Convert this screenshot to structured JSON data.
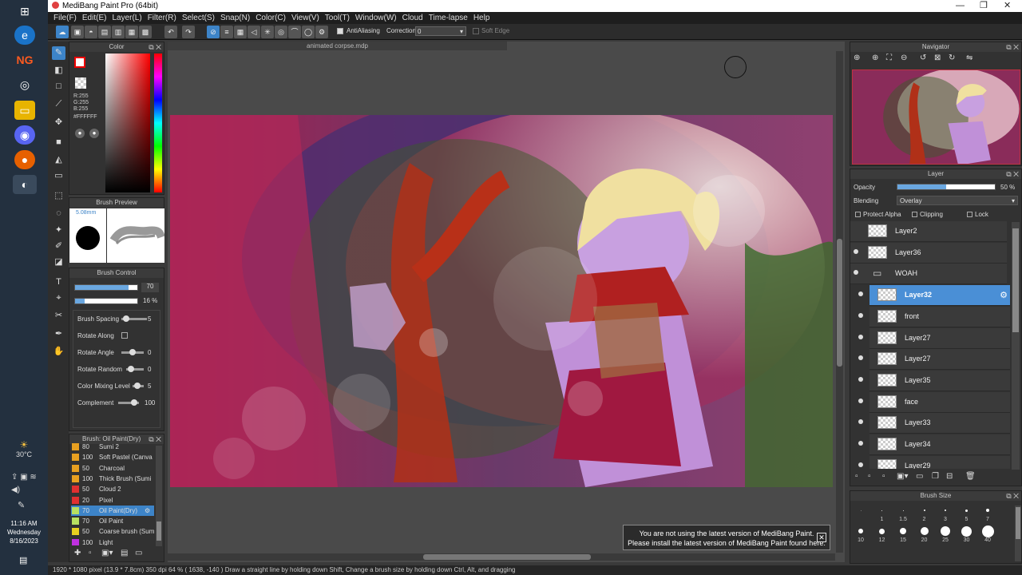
{
  "app": {
    "title": "MediBang Paint Pro (64bit)"
  },
  "menu": [
    "File(F)",
    "Edit(E)",
    "Layer(L)",
    "Filter(R)",
    "Select(S)",
    "Snap(N)",
    "Color(C)",
    "View(V)",
    "Tool(T)",
    "Window(W)",
    "Cloud",
    "Time-lapse",
    "Help"
  ],
  "toolbar": {
    "antialiasing": "AntiAliasing",
    "correction_label": "Correction",
    "correction_value": "0",
    "soft_edge": "Soft Edge"
  },
  "color_panel": {
    "title": "Color",
    "r": "R:255",
    "g": "G:255",
    "b": "B:255",
    "hex": "#FFFFFF"
  },
  "brush_preview": {
    "title": "Brush Preview",
    "size": "5.08mm"
  },
  "brush_control": {
    "title": "Brush Control",
    "size_value": "70",
    "opacity_value": "16 %",
    "spacing_label": "Brush Spacing",
    "spacing_value": "5",
    "rotate_along": "Rotate Along",
    "rotate_angle": "Rotate Angle",
    "rotate_angle_value": "0",
    "rotate_random": "Rotate Random",
    "rotate_random_value": "0",
    "color_mixing": "Color Mixing Level",
    "color_mixing_value": "5",
    "complement": "Complement",
    "complement_value": "100"
  },
  "brush_list": {
    "title": "Brush: Oil Paint(Dry)",
    "items": [
      {
        "size": "80",
        "name": "Sumi 2",
        "color": "#e8a020"
      },
      {
        "size": "100",
        "name": "Soft Pastel (Canva",
        "color": "#e8a020"
      },
      {
        "size": "50",
        "name": "Charcoal",
        "color": "#e8a020"
      },
      {
        "size": "100",
        "name": "Thick Brush (Sumi",
        "color": "#e8a020"
      },
      {
        "size": "50",
        "name": "Cloud 2",
        "color": "#e03030"
      },
      {
        "size": "20",
        "name": "Pixel",
        "color": "#e03030"
      },
      {
        "size": "70",
        "name": "Oil Paint(Dry)",
        "color": "#b8e060"
      },
      {
        "size": "70",
        "name": "Oil Paint",
        "color": "#b8e060"
      },
      {
        "size": "50",
        "name": "Coarse brush (Sum",
        "color": "#e8d020"
      },
      {
        "size": "100",
        "name": "Light",
        "color": "#c030e0"
      }
    ]
  },
  "document": {
    "tab": "animated corpse.mdp"
  },
  "navigator": {
    "title": "Navigator"
  },
  "layer_panel": {
    "title": "Layer",
    "opacity_label": "Opacity",
    "opacity_value": "50 %",
    "opacity_fraction": 0.5,
    "blending_label": "Blending",
    "blending_value": "Overlay",
    "protect_alpha": "Protect Alpha",
    "clipping": "Clipping",
    "lock": "Lock",
    "layers": [
      {
        "name": "Layer2"
      },
      {
        "name": "Layer36"
      },
      {
        "name": "WOAH"
      },
      {
        "name": "Layer32"
      },
      {
        "name": "front"
      },
      {
        "name": "Layer27"
      },
      {
        "name": "Layer27"
      },
      {
        "name": "Layer35"
      },
      {
        "name": "face"
      },
      {
        "name": "Layer33"
      },
      {
        "name": "Layer34"
      },
      {
        "name": "Layer29"
      }
    ]
  },
  "brush_size": {
    "title": "Brush Size",
    "sizes": [
      "1",
      "1.5",
      "2",
      "3",
      "5",
      "7",
      "10",
      "12",
      "15",
      "20",
      "25",
      "30",
      "40"
    ]
  },
  "notice": {
    "line1": "You are not using the latest version of MediBang Paint.",
    "line2": "Please install the latest version of MediBang Paint found here."
  },
  "status": {
    "text": "1920 * 1080 pixel  (13.9 * 7.8cm)  350 dpi  64 %  ( 1638, -140 )  Draw a straight line by holding down Shift, Change a brush size by holding down Ctrl, Alt, and dragging"
  },
  "taskbar": {
    "temp": "30°C",
    "time": "11:16 AM",
    "day": "Wednesday",
    "date": "8/16/2023"
  }
}
